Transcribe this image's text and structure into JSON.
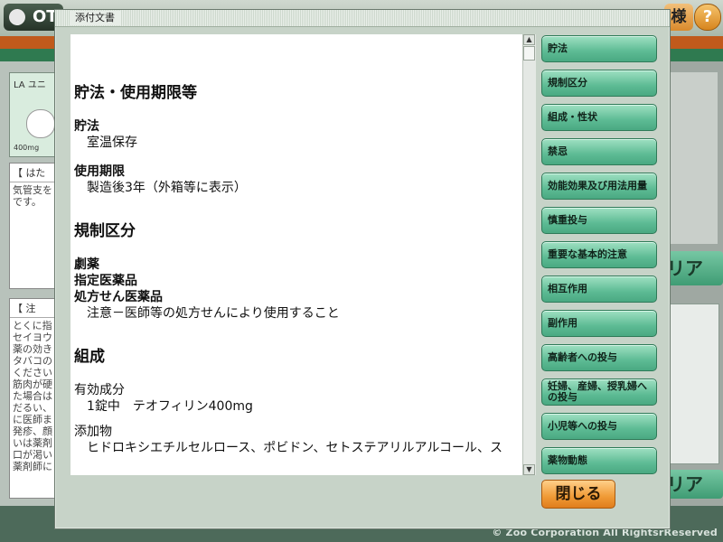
{
  "background": {
    "tab_label": "OT",
    "name_button": "様",
    "help_icon": "?",
    "card_top_text": "LA ユニ",
    "card_bottom_text": "400mg",
    "box1_title": "【 はた",
    "box1_text": "気管支を\nです。",
    "box2_title": "【 注",
    "box2_text": "とくに指\nセイヨウ\n薬の効き\nタバコの\nください\n筋肉が硬\nた場合は\nだるい、\nに医師ま\n発疹、顔\nいは薬剤\n口が渇い\n薬剤師に",
    "clear_label": "リア",
    "copyright": "© Zoo Corporation All RightsrReserved"
  },
  "dialog": {
    "title": "添付文書",
    "close_label": "閉じる"
  },
  "document": {
    "sec1_heading": "貯法・使用期限等",
    "storage_label": "貯法",
    "storage_value": "室温保存",
    "expiry_label": "使用期限",
    "expiry_value": "製造後3年（外箱等に表示）",
    "sec2_heading": "規制区分",
    "reg1": "劇薬",
    "reg2": "指定医薬品",
    "reg3": "処方せん医薬品",
    "reg_note": "注意－医師等の処方せんにより使用すること",
    "sec3_heading": "組成",
    "active_label": "有効成分",
    "active_value": "1錠中　テオフィリン400mg",
    "additive_label": "添加物",
    "additive_value": "ヒドロキシエチルセルロース、ポビドン、セトステアリルアルコール、ス"
  },
  "scrollbar": {
    "up_arrow": "▲",
    "down_arrow": "▼"
  },
  "nav": {
    "items": [
      "貯法",
      "規制区分",
      "組成・性状",
      "禁忌",
      "効能効果及び用法用量",
      "慎重投与",
      "重要な基本的注意",
      "相互作用",
      "副作用",
      "高齢者への投与",
      "妊婦、産婦、授乳婦への投与",
      "小児等への投与",
      "薬物動態"
    ]
  }
}
